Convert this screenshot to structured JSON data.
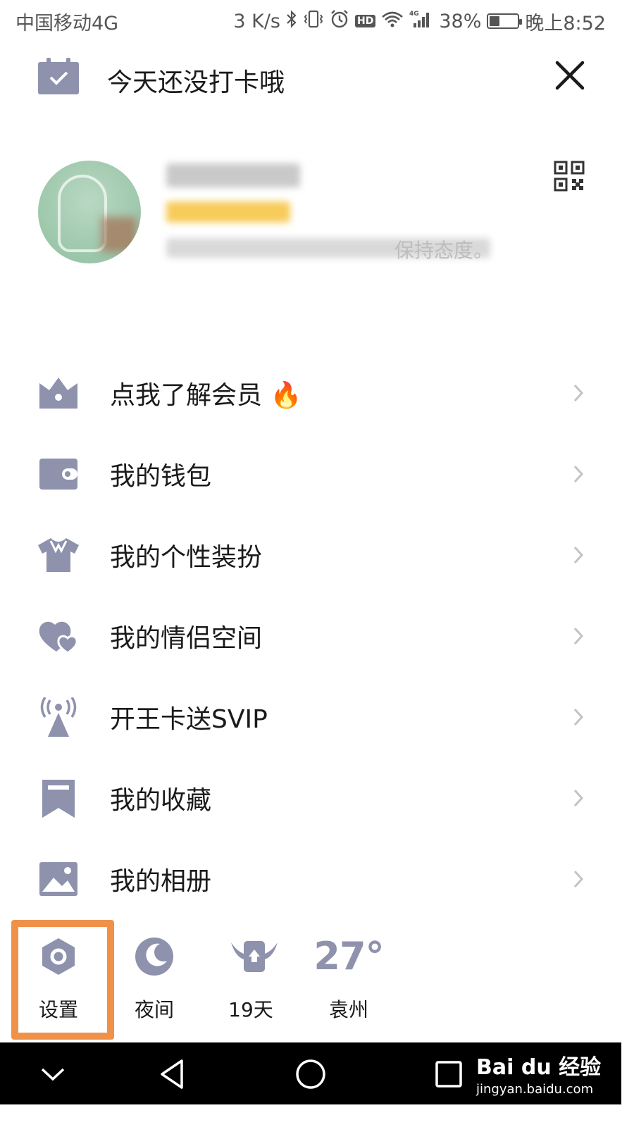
{
  "status_bar": {
    "carrier": "中国移动4G",
    "speed": "3 K/s",
    "network": "4G",
    "battery_pct": "38%",
    "battery_level": 0.38,
    "time": "晚上8:52",
    "hd": "HD"
  },
  "checkin": {
    "text": "今天还没打卡哦"
  },
  "profile": {
    "signature_tail": "保持态度。"
  },
  "menu": {
    "items": [
      {
        "label": "点我了解会员",
        "emoji": "🔥"
      },
      {
        "label": "我的钱包"
      },
      {
        "label": "我的个性装扮"
      },
      {
        "label": "我的情侣空间"
      },
      {
        "label": "开王卡送SVIP"
      },
      {
        "label": "我的收藏"
      },
      {
        "label": "我的相册"
      }
    ]
  },
  "tools": {
    "settings": "设置",
    "night": "夜间",
    "days": "19天",
    "temperature": "27°",
    "city": "袁州"
  },
  "watermark": {
    "logo": "Bai du 经验",
    "url": "jingyan.baidu.com"
  },
  "colors": {
    "icon": "#8e92ad",
    "highlight": "#f0914a",
    "text": "#1a1a1a"
  }
}
